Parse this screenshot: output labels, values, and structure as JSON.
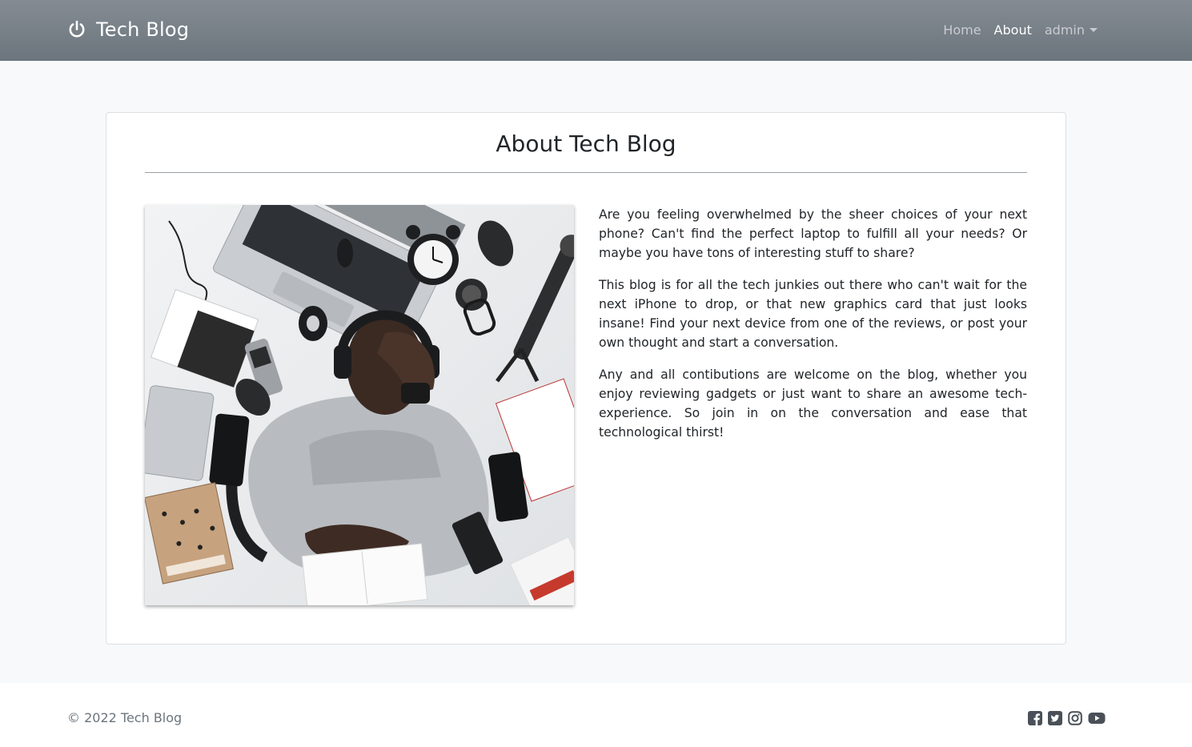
{
  "navbar": {
    "brand_icon": "power-icon",
    "brand_text": "Tech Blog",
    "links": [
      {
        "label": "Home",
        "active": false
      },
      {
        "label": "About",
        "active": true
      },
      {
        "label": "admin",
        "active": false,
        "dropdown": true
      }
    ]
  },
  "about": {
    "title": "About Tech Blog",
    "image_icon": "photo-man-with-headphones-and-gadgets",
    "paragraphs": [
      "Are you feeling overwhelmed by the sheer choices of your next phone? Can't find the perfect laptop to fulfill all your needs? Or maybe you have tons of interesting stuff to share?",
      "This blog is for all the tech junkies out there who can't wait for the next iPhone to drop, or that new graphics card that just looks insane! Find your next device from one of the reviews, or post your own thought and start a conversation.",
      "Any and all contibutions are welcome on the blog, whether you enjoy reviewing gadgets or just want to share an awesome tech-experience. So join in on the conversation and ease that technological thirst!"
    ]
  },
  "footer": {
    "copyright": "© 2022 Tech Blog",
    "social_icons": [
      "facebook-icon",
      "twitter-icon",
      "instagram-icon",
      "youtube-icon"
    ]
  },
  "colors": {
    "navbar": "#6c757d",
    "page_background": "#f8f9fa",
    "card_border": "#dcdfe3",
    "muted_text": "#6c757d",
    "social_icon": "#495057"
  }
}
